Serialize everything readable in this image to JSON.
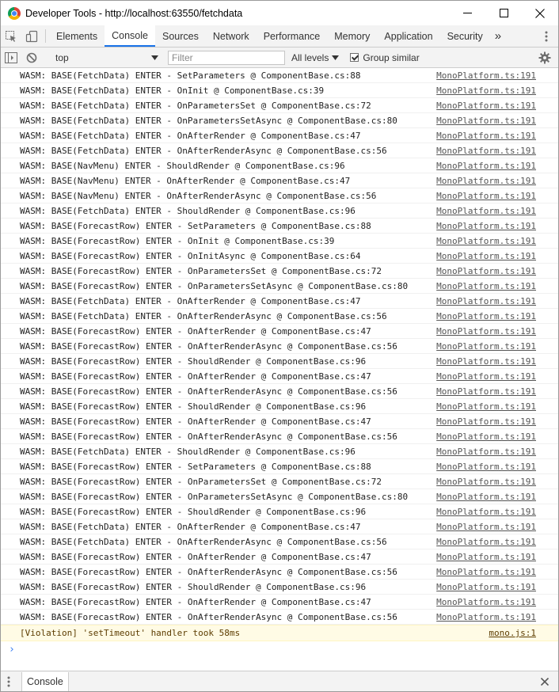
{
  "window": {
    "title": "Developer Tools - http://localhost:63550/fetchdata"
  },
  "tabs": [
    {
      "label": "Elements",
      "active": false
    },
    {
      "label": "Console",
      "active": true
    },
    {
      "label": "Sources",
      "active": false
    },
    {
      "label": "Network",
      "active": false
    },
    {
      "label": "Performance",
      "active": false
    },
    {
      "label": "Memory",
      "active": false
    },
    {
      "label": "Application",
      "active": false
    },
    {
      "label": "Security",
      "active": false
    }
  ],
  "tabs_overflow": "»",
  "console_toolbar": {
    "context": "top",
    "filter_placeholder": "Filter",
    "levels_label": "All levels",
    "group_similar_label": "Group similar",
    "group_similar_checked": true
  },
  "messages": [
    {
      "text": "WASM: BASE(FetchData) ENTER - SetParameters @ ComponentBase.cs:88",
      "source": "MonoPlatform.ts:191"
    },
    {
      "text": "WASM: BASE(FetchData) ENTER - OnInit @ ComponentBase.cs:39",
      "source": "MonoPlatform.ts:191"
    },
    {
      "text": "WASM: BASE(FetchData) ENTER - OnParametersSet @ ComponentBase.cs:72",
      "source": "MonoPlatform.ts:191"
    },
    {
      "text": "WASM: BASE(FetchData) ENTER - OnParametersSetAsync @ ComponentBase.cs:80",
      "source": "MonoPlatform.ts:191"
    },
    {
      "text": "WASM: BASE(FetchData) ENTER - OnAfterRender @ ComponentBase.cs:47",
      "source": "MonoPlatform.ts:191"
    },
    {
      "text": "WASM: BASE(FetchData) ENTER - OnAfterRenderAsync @ ComponentBase.cs:56",
      "source": "MonoPlatform.ts:191"
    },
    {
      "text": "WASM: BASE(NavMenu) ENTER - ShouldRender @ ComponentBase.cs:96",
      "source": "MonoPlatform.ts:191"
    },
    {
      "text": "WASM: BASE(NavMenu) ENTER - OnAfterRender @ ComponentBase.cs:47",
      "source": "MonoPlatform.ts:191"
    },
    {
      "text": "WASM: BASE(NavMenu) ENTER - OnAfterRenderAsync @ ComponentBase.cs:56",
      "source": "MonoPlatform.ts:191"
    },
    {
      "text": "WASM: BASE(FetchData) ENTER - ShouldRender @ ComponentBase.cs:96",
      "source": "MonoPlatform.ts:191"
    },
    {
      "text": "WASM: BASE(ForecastRow) ENTER - SetParameters @ ComponentBase.cs:88",
      "source": "MonoPlatform.ts:191"
    },
    {
      "text": "WASM: BASE(ForecastRow) ENTER - OnInit @ ComponentBase.cs:39",
      "source": "MonoPlatform.ts:191"
    },
    {
      "text": "WASM: BASE(ForecastRow) ENTER - OnInitAsync @ ComponentBase.cs:64",
      "source": "MonoPlatform.ts:191"
    },
    {
      "text": "WASM: BASE(ForecastRow) ENTER - OnParametersSet @ ComponentBase.cs:72",
      "source": "MonoPlatform.ts:191"
    },
    {
      "text": "WASM: BASE(ForecastRow) ENTER - OnParametersSetAsync @ ComponentBase.cs:80",
      "source": "MonoPlatform.ts:191"
    },
    {
      "text": "WASM: BASE(FetchData) ENTER - OnAfterRender @ ComponentBase.cs:47",
      "source": "MonoPlatform.ts:191"
    },
    {
      "text": "WASM: BASE(FetchData) ENTER - OnAfterRenderAsync @ ComponentBase.cs:56",
      "source": "MonoPlatform.ts:191"
    },
    {
      "text": "WASM: BASE(ForecastRow) ENTER - OnAfterRender @ ComponentBase.cs:47",
      "source": "MonoPlatform.ts:191"
    },
    {
      "text": "WASM: BASE(ForecastRow) ENTER - OnAfterRenderAsync @ ComponentBase.cs:56",
      "source": "MonoPlatform.ts:191"
    },
    {
      "text": "WASM: BASE(ForecastRow) ENTER - ShouldRender @ ComponentBase.cs:96",
      "source": "MonoPlatform.ts:191"
    },
    {
      "text": "WASM: BASE(ForecastRow) ENTER - OnAfterRender @ ComponentBase.cs:47",
      "source": "MonoPlatform.ts:191"
    },
    {
      "text": "WASM: BASE(ForecastRow) ENTER - OnAfterRenderAsync @ ComponentBase.cs:56",
      "source": "MonoPlatform.ts:191"
    },
    {
      "text": "WASM: BASE(ForecastRow) ENTER - ShouldRender @ ComponentBase.cs:96",
      "source": "MonoPlatform.ts:191"
    },
    {
      "text": "WASM: BASE(ForecastRow) ENTER - OnAfterRender @ ComponentBase.cs:47",
      "source": "MonoPlatform.ts:191"
    },
    {
      "text": "WASM: BASE(ForecastRow) ENTER - OnAfterRenderAsync @ ComponentBase.cs:56",
      "source": "MonoPlatform.ts:191"
    },
    {
      "text": "WASM: BASE(FetchData) ENTER - ShouldRender @ ComponentBase.cs:96",
      "source": "MonoPlatform.ts:191"
    },
    {
      "text": "WASM: BASE(ForecastRow) ENTER - SetParameters @ ComponentBase.cs:88",
      "source": "MonoPlatform.ts:191"
    },
    {
      "text": "WASM: BASE(ForecastRow) ENTER - OnParametersSet @ ComponentBase.cs:72",
      "source": "MonoPlatform.ts:191"
    },
    {
      "text": "WASM: BASE(ForecastRow) ENTER - OnParametersSetAsync @ ComponentBase.cs:80",
      "source": "MonoPlatform.ts:191"
    },
    {
      "text": "WASM: BASE(ForecastRow) ENTER - ShouldRender @ ComponentBase.cs:96",
      "source": "MonoPlatform.ts:191"
    },
    {
      "text": "WASM: BASE(FetchData) ENTER - OnAfterRender @ ComponentBase.cs:47",
      "source": "MonoPlatform.ts:191"
    },
    {
      "text": "WASM: BASE(FetchData) ENTER - OnAfterRenderAsync @ ComponentBase.cs:56",
      "source": "MonoPlatform.ts:191"
    },
    {
      "text": "WASM: BASE(ForecastRow) ENTER - OnAfterRender @ ComponentBase.cs:47",
      "source": "MonoPlatform.ts:191"
    },
    {
      "text": "WASM: BASE(ForecastRow) ENTER - OnAfterRenderAsync @ ComponentBase.cs:56",
      "source": "MonoPlatform.ts:191"
    },
    {
      "text": "WASM: BASE(ForecastRow) ENTER - ShouldRender @ ComponentBase.cs:96",
      "source": "MonoPlatform.ts:191"
    },
    {
      "text": "WASM: BASE(ForecastRow) ENTER - OnAfterRender @ ComponentBase.cs:47",
      "source": "MonoPlatform.ts:191"
    },
    {
      "text": "WASM: BASE(ForecastRow) ENTER - OnAfterRenderAsync @ ComponentBase.cs:56",
      "source": "MonoPlatform.ts:191"
    }
  ],
  "violation": {
    "text": "[Violation] 'setTimeout' handler took 58ms",
    "source": "mono.js:1"
  },
  "prompt_symbol": "›",
  "drawer": {
    "tab_label": "Console"
  },
  "colors": {
    "active_tab_underline": "#1a73e8",
    "warning_bg": "#fffbe5",
    "prompt": "#367cf1"
  }
}
